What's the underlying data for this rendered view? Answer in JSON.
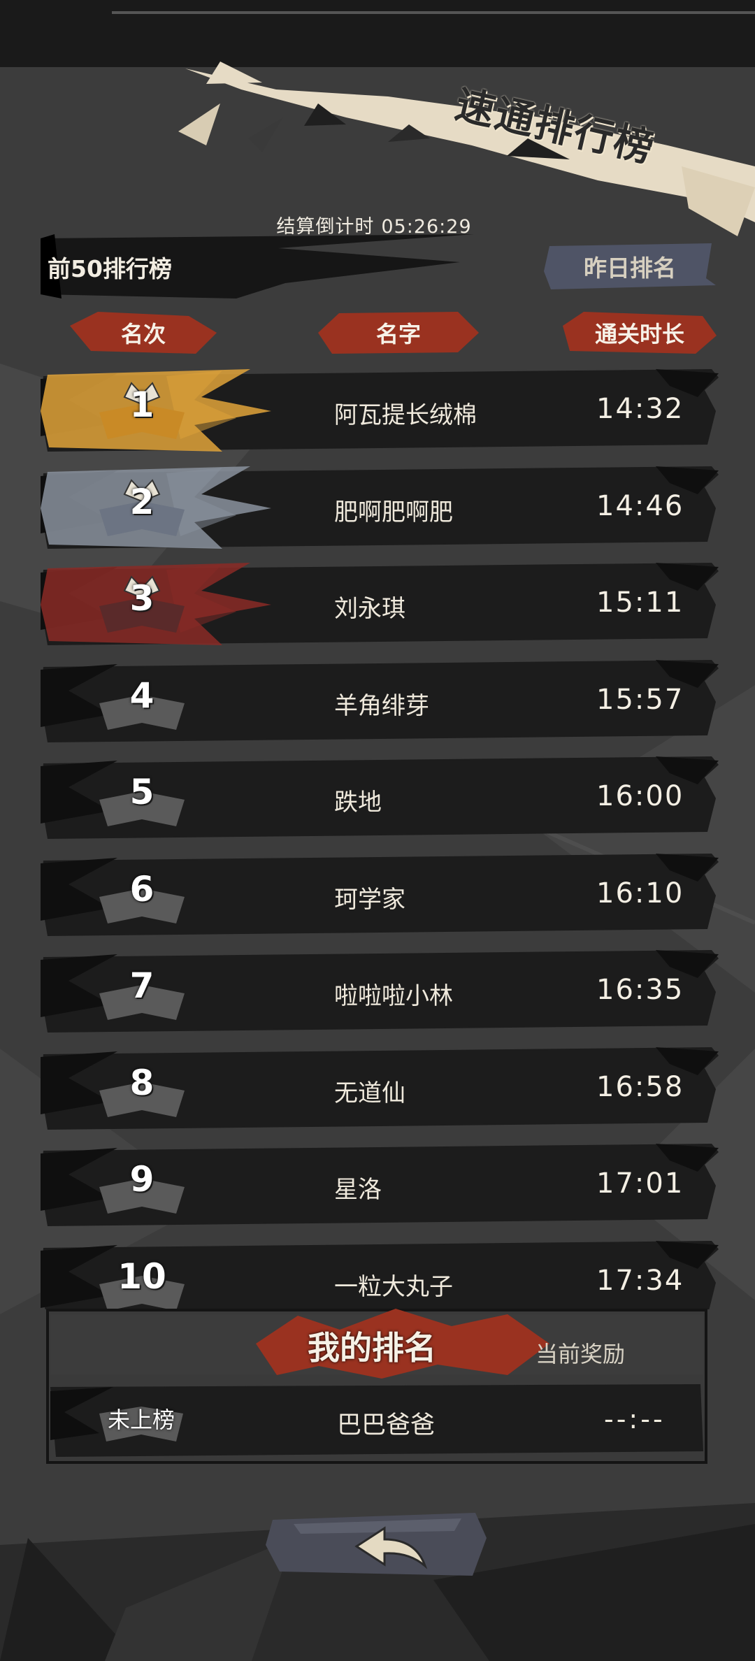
{
  "title": "速通排行榜",
  "countdown": {
    "label": "结算倒计时",
    "value": "05:26:29"
  },
  "tabs": {
    "top50": "前50排行榜",
    "yesterday": "昨日排名"
  },
  "columns": {
    "rank": "名次",
    "name": "名字",
    "time": "通关时长"
  },
  "rows": [
    {
      "rank": "1",
      "name": "阿瓦提长绒棉",
      "time": "14:32",
      "tier": "gold"
    },
    {
      "rank": "2",
      "name": "肥啊肥啊肥",
      "time": "14:46",
      "tier": "silver"
    },
    {
      "rank": "3",
      "name": "刘永琪",
      "time": "15:11",
      "tier": "bronze"
    },
    {
      "rank": "4",
      "name": "羊角绯芽",
      "time": "15:57",
      "tier": "normal"
    },
    {
      "rank": "5",
      "name": "跌地",
      "time": "16:00",
      "tier": "normal"
    },
    {
      "rank": "6",
      "name": "珂学家",
      "time": "16:10",
      "tier": "normal"
    },
    {
      "rank": "7",
      "name": "啦啦啦小林",
      "time": "16:35",
      "tier": "normal"
    },
    {
      "rank": "8",
      "name": "无道仙",
      "time": "16:58",
      "tier": "normal"
    },
    {
      "rank": "9",
      "name": "星洛",
      "time": "17:01",
      "tier": "normal"
    },
    {
      "rank": "10",
      "name": "一粒大丸子",
      "time": "17:34",
      "tier": "normal"
    }
  ],
  "my_rank": {
    "title": "我的排名",
    "reward_label": "当前奖励",
    "rank_label": "未上榜",
    "name": "巴巴爸爸",
    "time": "--:--"
  },
  "back_button": {
    "icon": "back-arrow-icon"
  },
  "colors": {
    "background": "#3c3c3c",
    "row_bg": "#1c1c1c",
    "gold": "#e0a33a",
    "silver": "#8a929e",
    "bronze": "#8a2a26",
    "accent_red": "#b23a24",
    "banner_cream": "#e6dbc5",
    "tab_blue": "#4f5466"
  }
}
